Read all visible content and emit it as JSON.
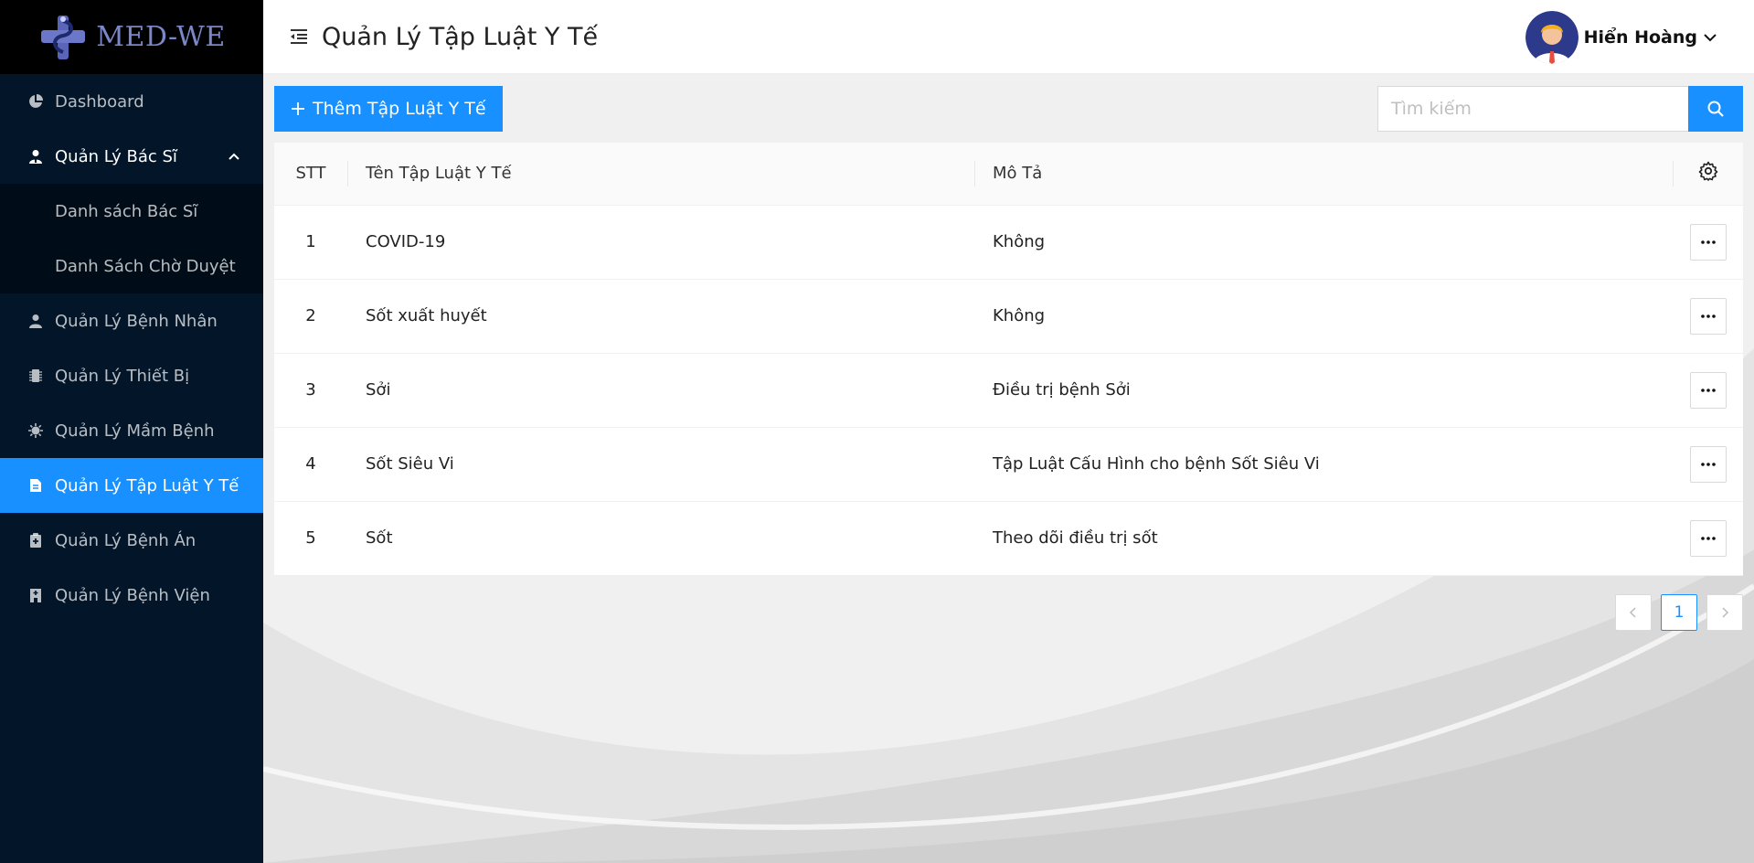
{
  "brand": {
    "name": "MED-WE"
  },
  "sidebar": {
    "items": [
      {
        "label": "Dashboard",
        "icon": "pie-chart-icon"
      },
      {
        "label": "Quản Lý Bác Sĩ",
        "icon": "doctor-icon",
        "expanded": true
      },
      {
        "label": "Danh sách Bác Sĩ"
      },
      {
        "label": "Danh Sách Chờ Duyệt"
      },
      {
        "label": "Quản Lý Bệnh Nhân",
        "icon": "user-icon"
      },
      {
        "label": "Quản Lý Thiết Bị",
        "icon": "chip-icon"
      },
      {
        "label": "Quản Lý Mầm Bệnh",
        "icon": "virus-icon"
      },
      {
        "label": "Quản Lý Tập Luật Y Tế",
        "icon": "file-icon",
        "active": true
      },
      {
        "label": "Quản Lý Bệnh Án",
        "icon": "medical-clipboard-icon"
      },
      {
        "label": "Quản Lý Bệnh Viện",
        "icon": "hospital-icon"
      }
    ]
  },
  "header": {
    "title": "Quản Lý Tập Luật Y Tế",
    "user_name": "Hiển Hoàng"
  },
  "toolbar": {
    "add_label": "Thêm Tập Luật Y Tế",
    "search_placeholder": "Tìm kiếm"
  },
  "table": {
    "columns": [
      "STT",
      "Tên Tập Luật Y Tế",
      "Mô Tả"
    ],
    "rows": [
      {
        "stt": "1",
        "name": "COVID-19",
        "desc": "Không"
      },
      {
        "stt": "2",
        "name": "Sốt xuất huyết",
        "desc": "Không"
      },
      {
        "stt": "3",
        "name": "Sởi",
        "desc": "Điều trị bệnh Sởi"
      },
      {
        "stt": "4",
        "name": "Sốt Siêu Vi",
        "desc": "Tập Luật Cấu Hình cho bệnh Sốt Siêu Vi"
      },
      {
        "stt": "5",
        "name": "Sốt",
        "desc": "Theo dõi điều trị sốt"
      }
    ]
  },
  "pagination": {
    "current": "1"
  },
  "colors": {
    "primary": "#1890ff",
    "sidebar_bg": "#021529",
    "logo_bg": "#000000"
  }
}
